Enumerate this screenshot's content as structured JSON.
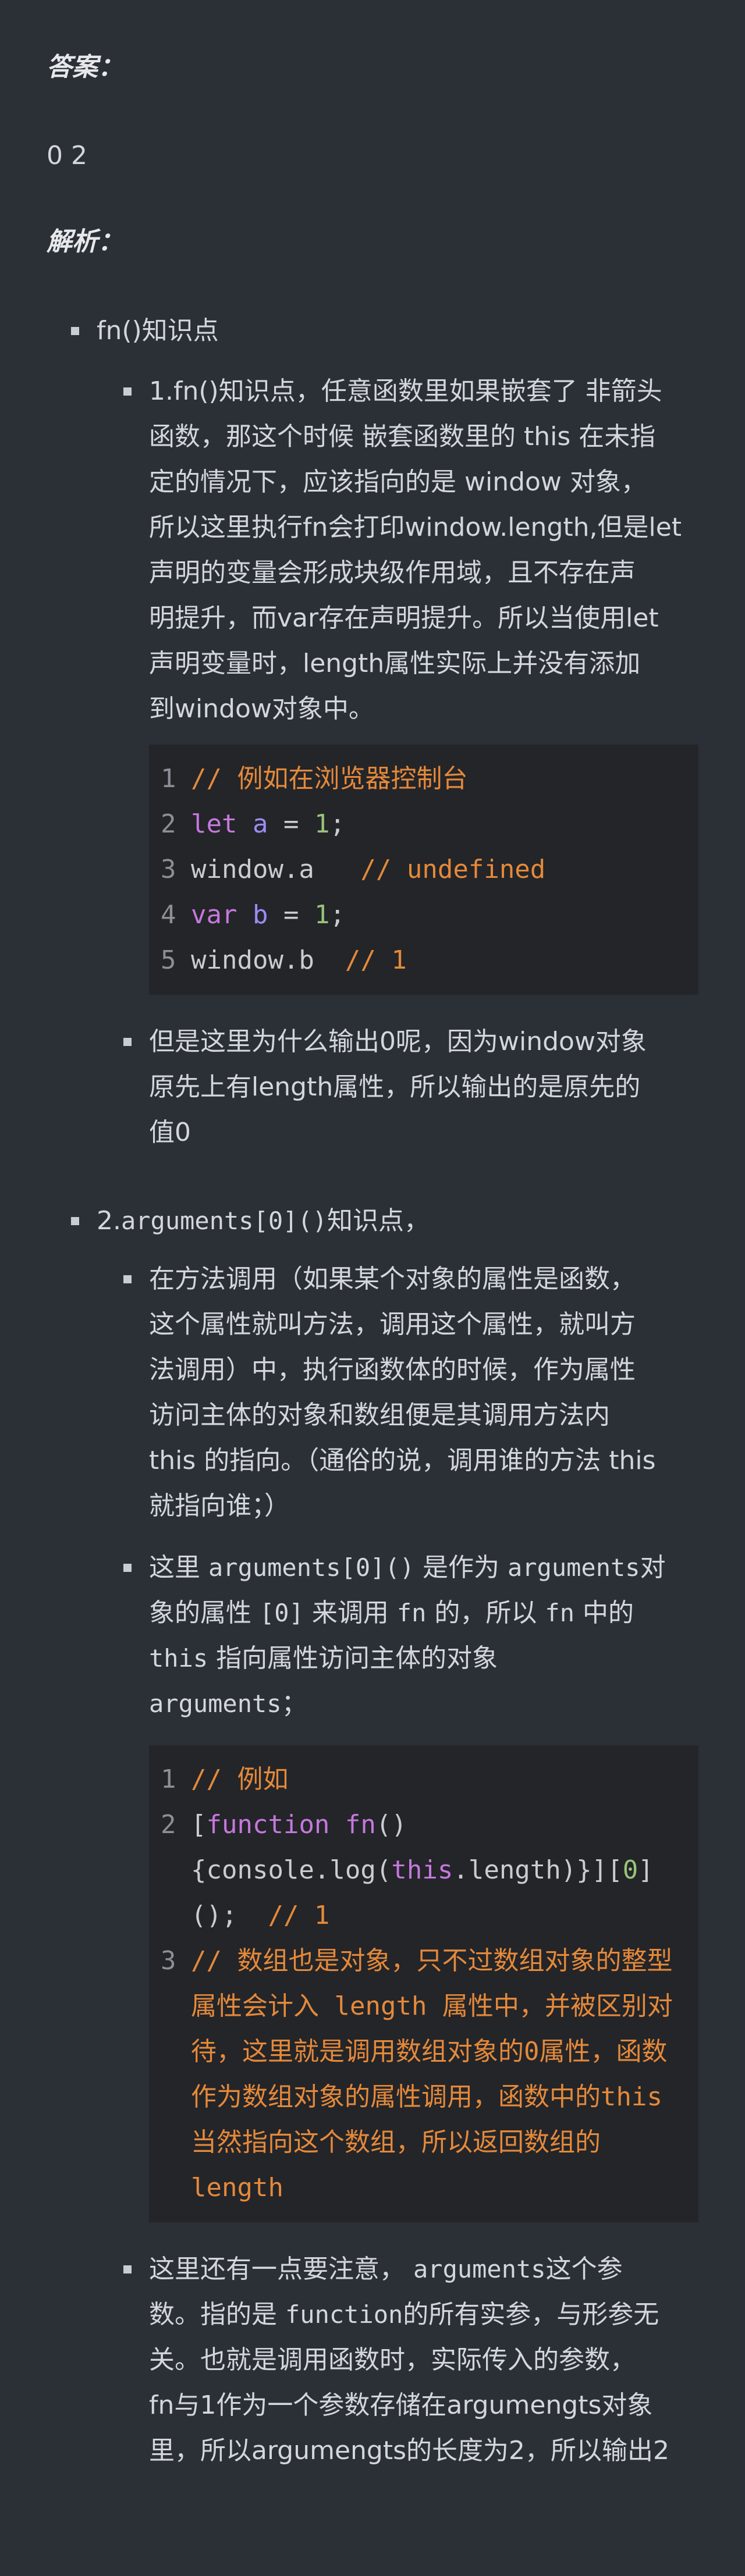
{
  "answer_heading": "答案：",
  "answer_value": "0 2",
  "analysis_heading": "解析：",
  "section1": {
    "title": "fn()知识点",
    "lines": [
      "1.fn()知识点，任意函数里如果嵌套了 非箭头",
      "函数，那这个时候 嵌套函数里的 this 在未指",
      "定的情况下，应该指向的是 window 对象，",
      "所以这里执行fn会打印window.length,但是let",
      "声明的变量会形成块级作用域，且不存在声",
      "明提升，而var存在声明提升。所以当使用let",
      "声明变量时，length属性实际上并没有添加",
      "到window对象中。"
    ],
    "code": {
      "l1": "// 例如在浏览器控制台",
      "l2_kw": "let",
      "l2_var": "a",
      "l2_eq": " = ",
      "l2_num": "1",
      "l2_end": ";",
      "l3_code": "window.a   ",
      "l3_comment": "// undefined",
      "l4_kw": "var",
      "l4_var": "b",
      "l4_eq": " = ",
      "l4_num": "1",
      "l4_end": ";",
      "l5_code": "window.b  ",
      "l5_comment": "// 1"
    },
    "note_lines": [
      "但是这里为什么输出0呢，因为window对象",
      "原先上有length属性，所以输出的是原先的",
      "值0"
    ]
  },
  "section2": {
    "title_prefix": "2.",
    "title_code": "arguments[0]()",
    "title_suffix": "知识点，",
    "p1_lines": [
      "在方法调用（如果某个对象的属性是函数，",
      "这个属性就叫方法，调用这个属性，就叫方",
      "法调用）中，执行函数体的时候，作为属性",
      "访问主体的对象和数组便是其调用方法内",
      "this 的指向。（通俗的说，调用谁的方法 this",
      "就指向谁；）"
    ],
    "p2": {
      "a": "这里 ",
      "b": "arguments[0]()",
      "c": " 是作为 ",
      "d": "arguments",
      "e": "对",
      "f": "象的属性 ",
      "g": "[0]",
      "h": " 来调用 ",
      "i": "fn",
      "j": " 的，所以 ",
      "k": "fn",
      "l": " 中的",
      "m": "this",
      "n": " 指向属性访问主体的对象",
      "o": "arguments",
      "p": "；"
    },
    "code": {
      "l1": "// 例如",
      "l2a": "[",
      "l2b": "function",
      "l2c": " ",
      "l2d": "fn",
      "l2e": "()",
      "l2f": "{console.log(",
      "l2g": "this",
      "l2h": ".length)}][",
      "l2i": "0",
      "l2j": "]",
      "l2k": "();  ",
      "l2l": "// 1",
      "l3_lines": [
        "// 数组也是对象，只不过数组对象的整型",
        "属性会计入 length 属性中，并被区别对",
        "待，这里就是调用数组对象的0属性，函数",
        "作为数组对象的属性调用，函数中的this",
        "当然指向这个数组，所以返回数组的",
        "length"
      ]
    },
    "p3": {
      "a": "这里还有一点要注意， ",
      "b": "arguments",
      "c": "这个参",
      "d": "数。指的是 ",
      "e": "function",
      "f": "的所有实参，与形参无",
      "g": "关。也就是调用函数时，实际传入的参数，",
      "h": "fn与1作为一个参数存储在argumengts对象",
      "i": "里，所以argumengts的长度为2，所以输出2"
    }
  }
}
